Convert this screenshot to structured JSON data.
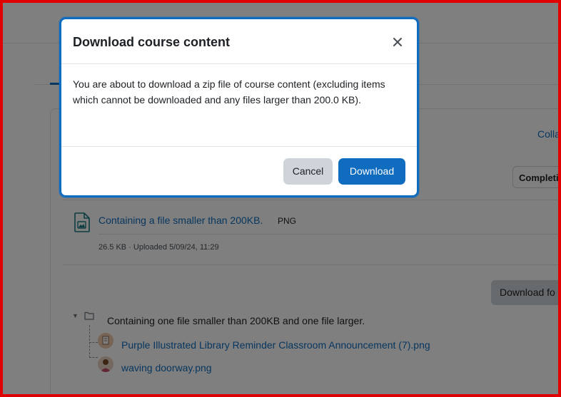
{
  "modal": {
    "title": "Download course content",
    "close_icon": "close-icon",
    "body": "You are about to download a zip file of course content (excluding items which cannot be downloaded and any files larger than 200.0 KB).",
    "cancel_label": "Cancel",
    "download_label": "Download"
  },
  "background": {
    "collapse_link": "Colla",
    "completion_button": "Completi",
    "file_activity": {
      "icon": "image-file-icon",
      "name": "Containing a file smaller than 200KB.",
      "type": "PNG",
      "meta": "26.5 KB · Uploaded 5/09/24, 11:29"
    },
    "download_folder_button": "Download fo",
    "folder": {
      "caret": "▼",
      "title": "Containing one file smaller than 200KB and one file larger.",
      "files": [
        {
          "name": "Purple Illustrated Library Reminder Classroom Announcement (7).png"
        },
        {
          "name": "waving doorway.png"
        }
      ]
    }
  },
  "colors": {
    "primary": "#0f6cbf",
    "secondary_button": "#ced4da",
    "frame": "#e00000",
    "text": "#1d2125"
  }
}
